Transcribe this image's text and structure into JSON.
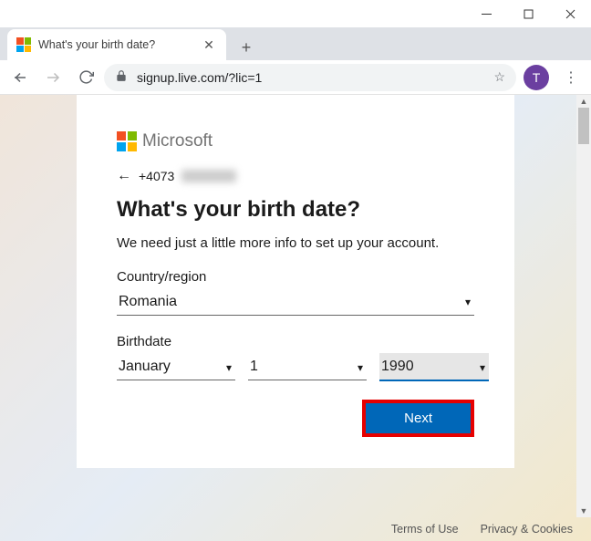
{
  "window": {
    "minimize": "−",
    "maximize": "☐",
    "close": "✕"
  },
  "tab": {
    "title": "What's your birth date?"
  },
  "toolbar": {
    "url": "signup.live.com/?lic=1",
    "avatar_letter": "T"
  },
  "brand": {
    "name": "Microsoft"
  },
  "identity": {
    "phone_prefix": "+4073"
  },
  "heading": "What's your birth date?",
  "subtext": "We need just a little more info to set up your account.",
  "labels": {
    "country": "Country/region",
    "birthdate": "Birthdate"
  },
  "form": {
    "country": "Romania",
    "month": "January",
    "day": "1",
    "year": "1990"
  },
  "actions": {
    "next": "Next"
  },
  "footer": {
    "terms": "Terms of Use",
    "privacy": "Privacy & Cookies"
  }
}
